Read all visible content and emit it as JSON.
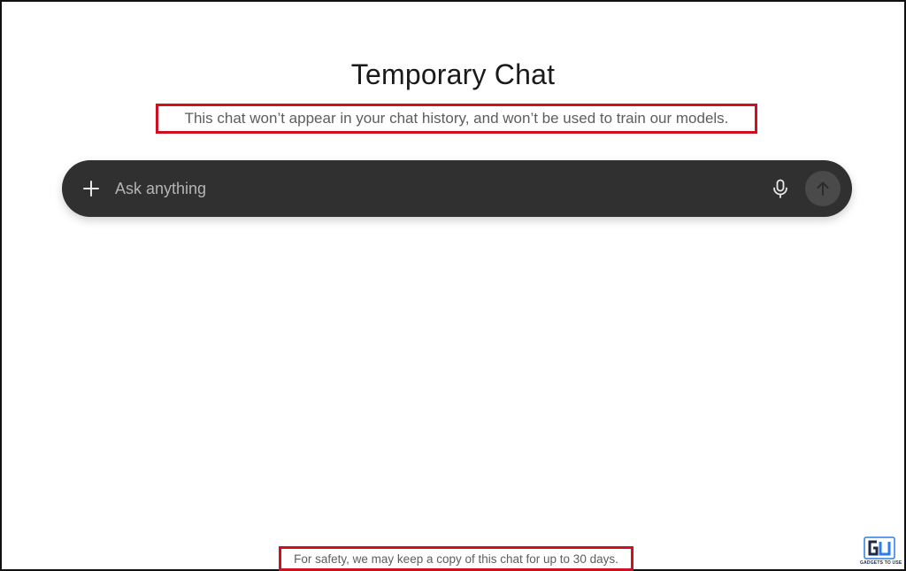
{
  "header": {
    "title": "Temporary Chat",
    "subtitle": "This chat won’t appear in your chat history, and won’t be used to train our models."
  },
  "composer": {
    "placeholder": "Ask anything",
    "plus_icon": "plus-icon",
    "mic_icon": "microphone-icon",
    "send_icon": "arrow-up-icon",
    "background_color": "#303030"
  },
  "footer": {
    "note": "For safety, we may keep a copy of this chat for up to 30 days."
  },
  "annotations": {
    "highlight_color": "#d0101e"
  },
  "watermark": {
    "brand_text": "GADGETS TO USE",
    "logo_colors": [
      "#2b7de9",
      "#1e2a4a"
    ]
  }
}
